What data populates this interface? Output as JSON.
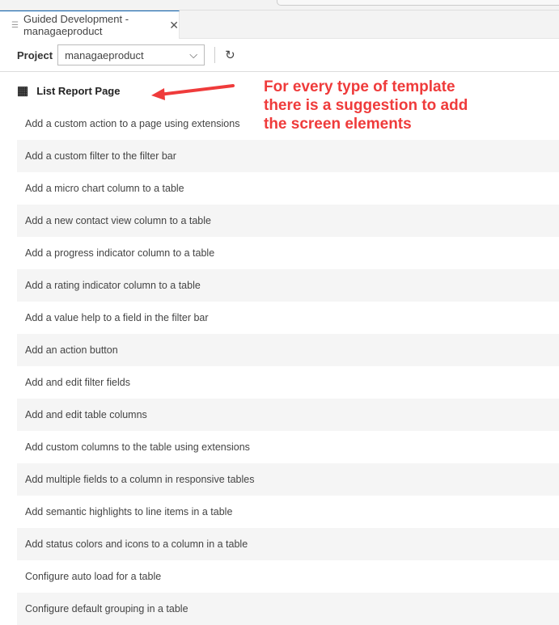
{
  "tab": {
    "title": "Guided Development - managaeproduct"
  },
  "toolbar": {
    "project_label": "Project",
    "project_value": "managaeproduct"
  },
  "section": {
    "title": "List Report Page"
  },
  "annotation": {
    "text": "For every type of template\nthere is a suggestion to add\nthe screen elements",
    "color": "#ef3b3b"
  },
  "items": [
    "Add a custom action to a page using extensions",
    "Add a custom filter to the filter bar",
    "Add a micro chart column to a table",
    "Add a new contact view column to a table",
    "Add a progress indicator column to a table",
    "Add a rating indicator column to a table",
    "Add a value help to a field in the filter bar",
    "Add an action button",
    "Add and edit filter fields",
    "Add and edit table columns",
    "Add custom columns to the table using extensions",
    "Add multiple fields to a column in responsive tables",
    "Add semantic highlights to line items in a table",
    "Add status colors and icons to a column in a table",
    "Configure auto load for a table",
    "Configure default grouping in a table"
  ]
}
